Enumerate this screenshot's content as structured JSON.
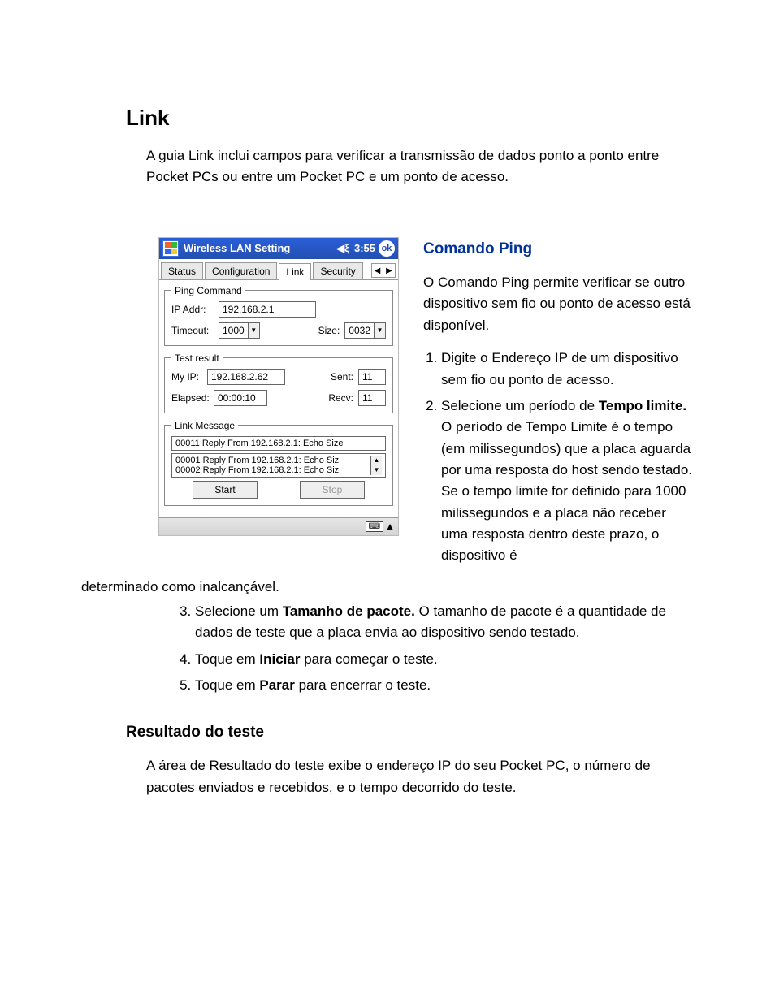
{
  "title": "Link",
  "intro": "A guia Link inclui campos para verificar a transmissão de dados ponto a ponto entre Pocket PCs ou entre um Pocket PC e um ponto de acesso.",
  "section_ping_title": "Comando Ping",
  "section_ping_intro": "O Comando Ping permite verificar se outro dispositivo sem fio ou ponto de acesso está disponível.",
  "steps": {
    "s1": "Digite o Endereço IP de um dispositivo sem fio ou ponto de acesso.",
    "s2_a": "Selecione um período de ",
    "s2_b": "Tempo limite.",
    "s2_c": " O período de Tempo Limite é o tempo (em milissegundos) que a placa aguarda por uma resposta do host sendo testado. Se o tempo limite for definido para 1000 milissegundos e a placa não receber uma resposta dentro deste prazo, o dispositivo é",
    "s2_wrap": "determinado como inalcançável.",
    "s3_a": "Selecione um ",
    "s3_b": "Tamanho de pacote.",
    "s3_c": " O tamanho de pacote é a quantidade de dados de teste que a placa envia ao dispositivo sendo testado.",
    "s4_a": "Toque em ",
    "s4_b": "Iniciar",
    "s4_c": " para começar o teste.",
    "s5_a": "Toque em ",
    "s5_b": "Parar",
    "s5_c": " para encerrar o teste."
  },
  "result_title": "Resultado do teste",
  "result_intro": "A área de Resultado do teste exibe o endereço IP do seu Pocket PC, o número de pacotes enviados e recebidos, e o tempo decorrido do teste.",
  "ppc": {
    "app_title": "Wireless LAN Setting",
    "time": "3:55",
    "ok": "ok",
    "tabs": {
      "status": "Status",
      "config": "Configuration",
      "link": "Link",
      "security": "Security"
    },
    "arrows": {
      "left": "◀",
      "right": "▶"
    },
    "ping_legend": "Ping Command",
    "ip_label": "IP Addr:",
    "ip_value": "192.168.2.1",
    "timeout_label": "Timeout:",
    "timeout_value": "1000",
    "size_label": "Size:",
    "size_value": "0032",
    "test_legend": "Test result",
    "myip_label": "My IP:",
    "myip_value": "192.168.2.62",
    "sent_label": "Sent:",
    "sent_value": "11",
    "elapsed_label": "Elapsed:",
    "elapsed_value": "00:00:10",
    "recv_label": "Recv:",
    "recv_value": "11",
    "link_legend": "Link Message",
    "msg_top": "00011 Reply From 192.168.2.1: Echo Size",
    "msg_line1": "00001 Reply From 192.168.2.1: Echo Siz",
    "msg_line2": "00002 Reply From 192.168.2.1: Echo Siz",
    "start_btn": "Start",
    "stop_btn": "Stop",
    "kbd": "⌨",
    "tri": "▲"
  }
}
